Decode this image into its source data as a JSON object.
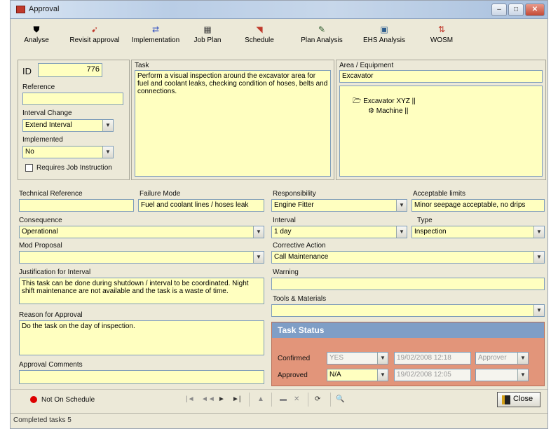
{
  "window": {
    "title": "Approval",
    "min": "–",
    "max": "□",
    "close": "✕"
  },
  "toolbar": {
    "items": [
      {
        "label": "Analyse",
        "icon": "⛊"
      },
      {
        "label": "Revisit approval",
        "icon": "➹"
      },
      {
        "label": "Implementation",
        "icon": "⇄"
      },
      {
        "label": "Job Plan",
        "icon": "▦"
      },
      {
        "label": "Schedule",
        "icon": "◥"
      },
      {
        "label": "Plan Analysis",
        "icon": "✎"
      },
      {
        "label": "EHS Analysis",
        "icon": "▣"
      },
      {
        "label": "WOSM",
        "icon": "⇅"
      }
    ]
  },
  "left": {
    "id_label": "ID",
    "id_value": "776",
    "reference_label": "Reference",
    "reference_value": "",
    "interval_change_label": "Interval Change",
    "interval_change_value": "Extend Interval",
    "implemented_label": "Implemented",
    "implemented_value": "No",
    "checkbox_label": "Requires Job Instruction"
  },
  "task": {
    "label": "Task",
    "text": "Perform a visual inspection around the excavator area for fuel and coolant leaks, checking condition of hoses, belts and connections."
  },
  "area": {
    "label": "Area / Equipment",
    "value": "Excavator",
    "tree": [
      {
        "label": "Excavator XYZ ||",
        "icon": "folder-open-icon"
      },
      {
        "label": "Machine ||",
        "icon": "machine-icon"
      }
    ]
  },
  "mid": {
    "technical_ref_label": "Technical Reference",
    "technical_ref_value": "",
    "failure_mode_label": "Failure Mode",
    "failure_mode_value": "Fuel and coolant lines / hoses leak",
    "consequence_label": "Consequence",
    "consequence_value": "Operational",
    "mod_proposal_label": "Mod Proposal",
    "mod_proposal_value": "",
    "justification_label": "Justification for Interval",
    "justification_value": "This task can be done during shutdown / interval to be coordinated. Night shift maintenance are not available and the task is a waste of time.",
    "reason_label": "Reason for Approval",
    "reason_value": "Do the task on the day of inspection.",
    "comments_label": "Approval Comments",
    "comments_value": ""
  },
  "right": {
    "responsibility_label": "Responsibility",
    "responsibility_value": "Engine Fitter",
    "acceptable_label": "Acceptable limits",
    "acceptable_value": "Minor seepage acceptable, no drips",
    "interval_label": "Interval",
    "interval_value": "1 day",
    "type_label": "Type",
    "type_value": "Inspection",
    "corrective_label": "Corrective Action",
    "corrective_value": "Call Maintenance",
    "warning_label": "Warning",
    "warning_value": "",
    "tools_label": "Tools & Materials",
    "tools_value": ""
  },
  "task_status": {
    "title": "Task Status",
    "rows": [
      {
        "label": "Confirmed",
        "who": "YES",
        "date": "19/02/2008 12:18",
        "extra": "Approver"
      },
      {
        "label": "Approved",
        "who": "N/A",
        "date": "19/02/2008 12:05",
        "extra": ""
      }
    ]
  },
  "bottom": {
    "new_schedule": "Not On Schedule",
    "nav": [
      "|◄",
      "◄◄",
      "►",
      "►|",
      "▲",
      "▬",
      "✕",
      "⟳",
      "🔍"
    ],
    "close_label": "Close"
  },
  "status": {
    "text": "Completed tasks 5"
  },
  "colors": {
    "field_yellow": "#ffffc0",
    "task_header": "#7f9ec6",
    "task_bg": "#e2957a"
  }
}
